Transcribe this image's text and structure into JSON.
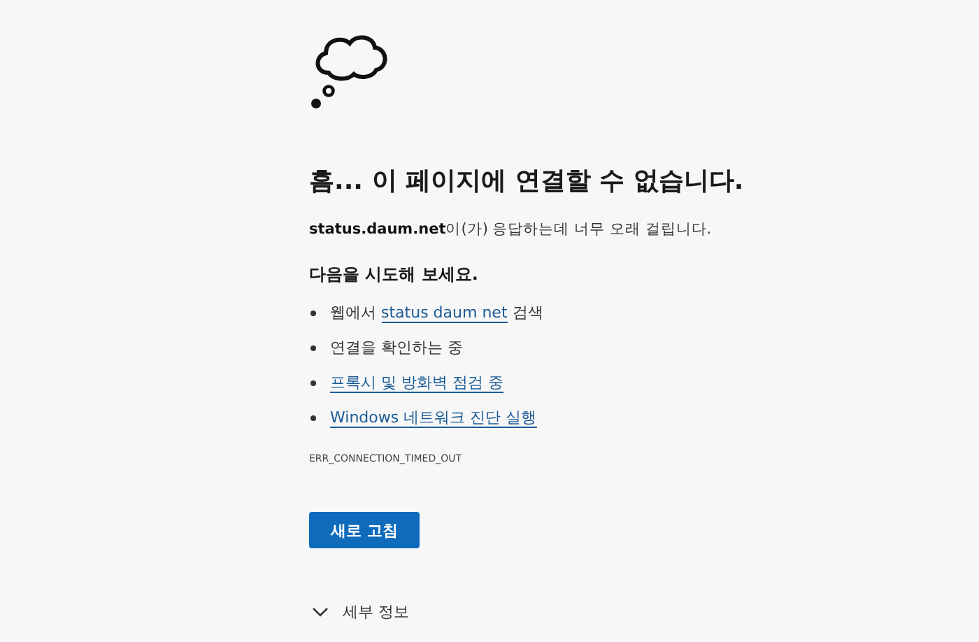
{
  "heading": "흠... 이 페이지에 연결할 수 없습니다.",
  "message": {
    "host": "status.daum.net",
    "rest": "이(가) 응답하는데 너무 오래 걸립니다."
  },
  "suggestions_title": "다음을 시도해 보세요.",
  "suggestions": [
    {
      "parts": [
        {
          "text": "웹에서 ",
          "kind": "text"
        },
        {
          "text": "status daum net",
          "kind": "link"
        },
        {
          "text": " 검색",
          "kind": "text"
        }
      ]
    },
    {
      "parts": [
        {
          "text": "연결을 확인하는 중",
          "kind": "text"
        }
      ]
    },
    {
      "parts": [
        {
          "text": "프록시 및 방화벽 점검 중",
          "kind": "link"
        }
      ]
    },
    {
      "parts": [
        {
          "text": "Windows 네트워크 진단 실행",
          "kind": "link"
        }
      ]
    }
  ],
  "error_code": "ERR_CONNECTION_TIMED_OUT",
  "button": "새로 고침",
  "details": {
    "label": "세부 정보",
    "expanded": false
  }
}
